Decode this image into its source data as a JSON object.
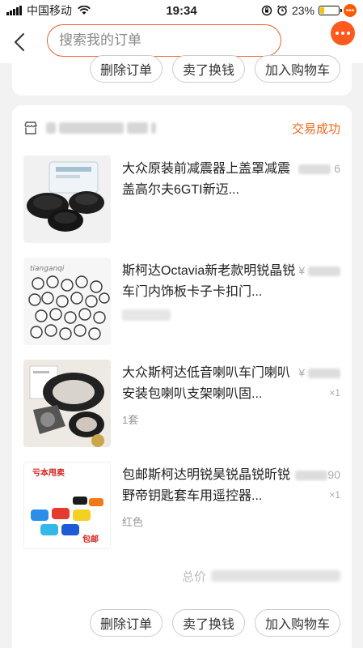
{
  "status_bar": {
    "carrier": "中国移动",
    "time": "19:34",
    "battery": "23%",
    "battery_level": 0.23
  },
  "nav": {
    "search_placeholder": "搜索我的订单"
  },
  "previous_order": {
    "actions": [
      "删除订单",
      "卖了换钱",
      "加入购物车"
    ]
  },
  "order": {
    "status": "交易成功",
    "items": [
      {
        "title": "大众原装前减震器上盖罩减震盖高尔夫6GTI新迈...",
        "spec": "",
        "price_visible": "6",
        "qty": ""
      },
      {
        "title": "斯柯达Octavia新老款明锐晶锐车门内饰板卡子卡扣门...",
        "spec": "",
        "price_visible": "¥",
        "qty": "",
        "image_text": "tianganqi"
      },
      {
        "title": "大众斯柯达低音喇叭车门喇叭安装包喇叭支架喇叭固...",
        "spec": "1套",
        "price_visible": "¥",
        "qty": "×1"
      },
      {
        "title": "包邮斯柯达明锐昊锐晶锐昕锐野帝钥匙套车用遥控器...",
        "spec": "红色",
        "price_visible": "90",
        "qty": "×1",
        "image_text_top": "亏本甩卖",
        "image_text_bottom": "包邮"
      }
    ],
    "total_label": "总价",
    "actions": [
      "删除订单",
      "卖了换钱",
      "加入购物车"
    ]
  },
  "colors": {
    "accent": "#f0651a",
    "search_border": "#e8622a",
    "background": "#f2f2f2"
  }
}
